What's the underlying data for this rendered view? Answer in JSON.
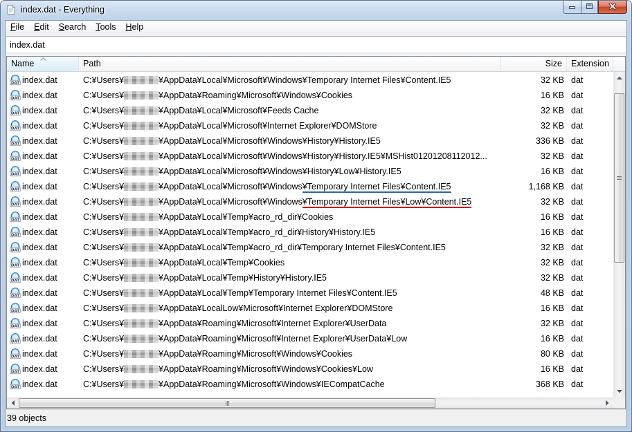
{
  "window": {
    "title": "index.dat - Everything"
  },
  "menu": [
    {
      "accel": "F",
      "rest": "ile"
    },
    {
      "accel": "E",
      "rest": "dit"
    },
    {
      "accel": "S",
      "rest": "earch"
    },
    {
      "accel": "T",
      "rest": "ools"
    },
    {
      "accel": "H",
      "rest": "elp"
    }
  ],
  "search": {
    "value": "index.dat"
  },
  "columns": {
    "name": "Name",
    "path": "Path",
    "size": "Size",
    "extension": "Extension",
    "sort_icon": "sort-up-icon"
  },
  "file_icon": {
    "icon": "dat-file-icon",
    "label": "DAT"
  },
  "rows": [
    {
      "name": "index.dat",
      "path_head": "C:¥Users¥",
      "path_tail": "¥AppData¥Local¥Microsoft¥Windows¥Temporary Internet Files¥Content.IE5",
      "size": "32 KB",
      "ext": "dat"
    },
    {
      "name": "index.dat",
      "path_head": "C:¥Users¥",
      "path_tail": "¥AppData¥Roaming¥Microsoft¥Windows¥Cookies",
      "size": "16 KB",
      "ext": "dat"
    },
    {
      "name": "index.dat",
      "path_head": "C:¥Users¥",
      "path_tail": "¥AppData¥Local¥Microsoft¥Feeds Cache",
      "size": "32 KB",
      "ext": "dat"
    },
    {
      "name": "index.dat",
      "path_head": "C:¥Users¥",
      "path_tail": "¥AppData¥Local¥Microsoft¥Internet Explorer¥DOMStore",
      "size": "32 KB",
      "ext": "dat"
    },
    {
      "name": "index.dat",
      "path_head": "C:¥Users¥",
      "path_tail": "¥AppData¥Local¥Microsoft¥Windows¥History¥History.IE5",
      "size": "336 KB",
      "ext": "dat"
    },
    {
      "name": "index.dat",
      "path_head": "C:¥Users¥",
      "path_tail": "¥AppData¥Local¥Microsoft¥Windows¥History¥History.IE5¥MSHist01201208112012...",
      "size": "32 KB",
      "ext": "dat"
    },
    {
      "name": "index.dat",
      "path_head": "C:¥Users¥",
      "path_tail": "¥AppData¥Local¥Microsoft¥Windows¥History¥Low¥History.IE5",
      "size": "16 KB",
      "ext": "dat"
    },
    {
      "name": "index.dat",
      "path_head": "C:¥Users¥",
      "path_tail": "¥AppData¥Local¥Microsoft¥Windows",
      "path_mark": "¥Temporary Internet Files¥Content.IE5",
      "mark_color": "#1e6aa6",
      "size": "1,168 KB",
      "ext": "dat"
    },
    {
      "name": "index.dat",
      "path_head": "C:¥Users¥",
      "path_tail": "¥AppData¥Local¥Microsoft¥Windows",
      "path_mark": "¥Temporary Internet Files¥Low¥Content.IE5",
      "mark_color": "#d0141c",
      "size": "32 KB",
      "ext": "dat"
    },
    {
      "name": "index.dat",
      "path_head": "C:¥Users¥",
      "path_tail": "¥AppData¥Local¥Temp¥acro_rd_dir¥Cookies",
      "size": "16 KB",
      "ext": "dat"
    },
    {
      "name": "index.dat",
      "path_head": "C:¥Users¥",
      "path_tail": "¥AppData¥Local¥Temp¥acro_rd_dir¥History¥History.IE5",
      "size": "16 KB",
      "ext": "dat"
    },
    {
      "name": "index.dat",
      "path_head": "C:¥Users¥",
      "path_tail": "¥AppData¥Local¥Temp¥acro_rd_dir¥Temporary Internet Files¥Content.IE5",
      "size": "32 KB",
      "ext": "dat"
    },
    {
      "name": "index.dat",
      "path_head": "C:¥Users¥",
      "path_tail": "¥AppData¥Local¥Temp¥Cookies",
      "size": "32 KB",
      "ext": "dat"
    },
    {
      "name": "index.dat",
      "path_head": "C:¥Users¥",
      "path_tail": "¥AppData¥Local¥Temp¥History¥History.IE5",
      "size": "32 KB",
      "ext": "dat"
    },
    {
      "name": "index.dat",
      "path_head": "C:¥Users¥",
      "path_tail": "¥AppData¥Local¥Temp¥Temporary Internet Files¥Content.IE5",
      "size": "48 KB",
      "ext": "dat"
    },
    {
      "name": "index.dat",
      "path_head": "C:¥Users¥",
      "path_tail": "¥AppData¥LocalLow¥Microsoft¥Internet Explorer¥DOMStore",
      "size": "16 KB",
      "ext": "dat"
    },
    {
      "name": "index.dat",
      "path_head": "C:¥Users¥",
      "path_tail": "¥AppData¥Roaming¥Microsoft¥Internet Explorer¥UserData",
      "size": "32 KB",
      "ext": "dat"
    },
    {
      "name": "index.dat",
      "path_head": "C:¥Users¥",
      "path_tail": "¥AppData¥Roaming¥Microsoft¥Internet Explorer¥UserData¥Low",
      "size": "16 KB",
      "ext": "dat"
    },
    {
      "name": "index.dat",
      "path_head": "C:¥Users¥",
      "path_tail": "¥AppData¥Roaming¥Microsoft¥Windows¥Cookies",
      "size": "80 KB",
      "ext": "dat"
    },
    {
      "name": "index.dat",
      "path_head": "C:¥Users¥",
      "path_tail": "¥AppData¥Roaming¥Microsoft¥Windows¥Cookies¥Low",
      "size": "16 KB",
      "ext": "dat"
    },
    {
      "name": "index.dat",
      "path_head": "C:¥Users¥",
      "path_tail": "¥AppData¥Roaming¥Microsoft¥Windows¥IECompatCache",
      "size": "368 KB",
      "ext": "dat"
    }
  ],
  "status": {
    "text": "39 objects"
  },
  "colors": {
    "close_button": "#c7452a",
    "frame": "#b8cde7",
    "sort_arrow": "#97a9bf"
  }
}
